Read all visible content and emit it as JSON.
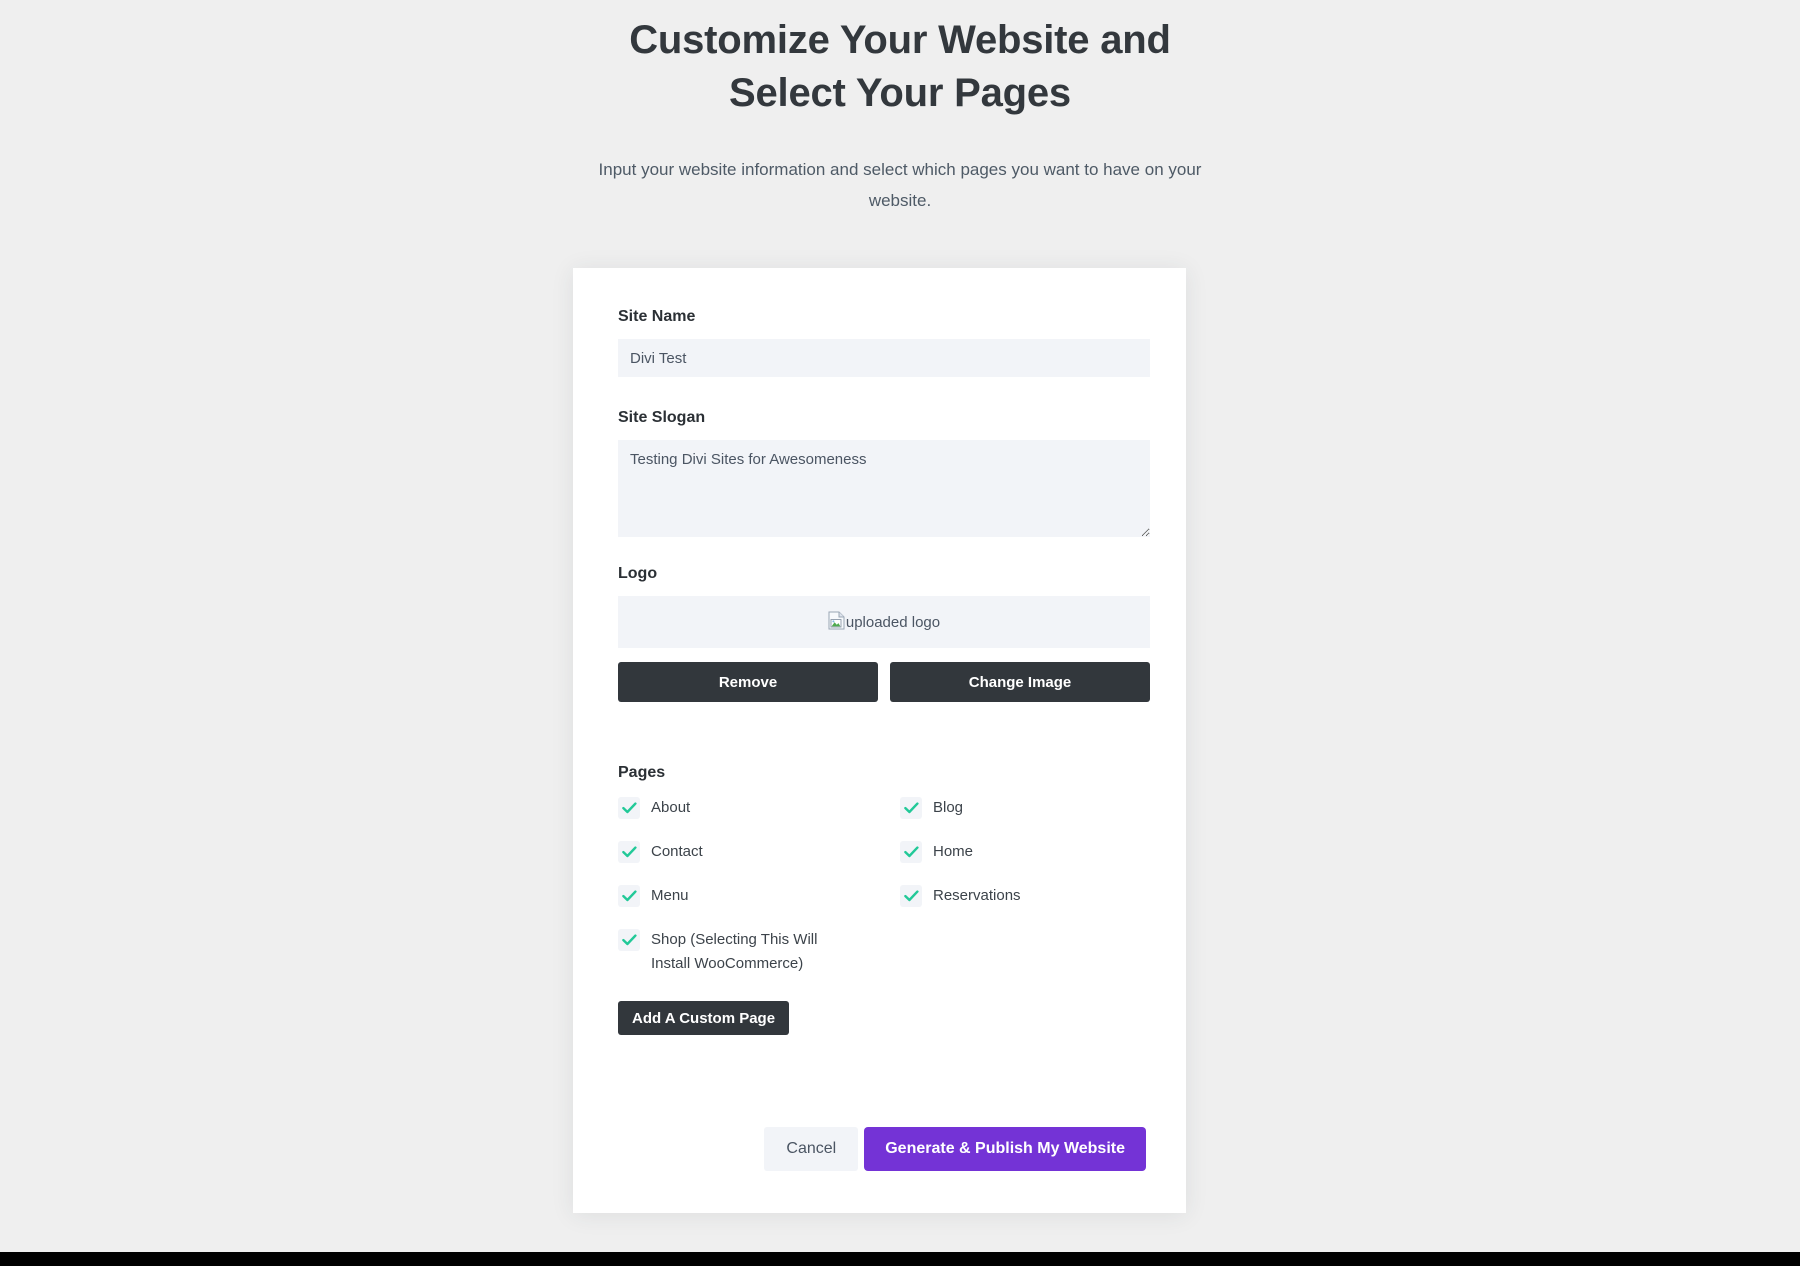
{
  "header": {
    "title": "Customize Your Website and Select Your Pages",
    "subtitle": "Input your website information and select which pages you want to have on your website."
  },
  "form": {
    "site_name": {
      "label": "Site Name",
      "value": "Divi Test",
      "placeholder": "Site Name"
    },
    "site_slogan": {
      "label": "Site Slogan",
      "value": "Testing Divi Sites for Awesomeness",
      "placeholder": "Site Slogan"
    },
    "logo": {
      "label": "Logo",
      "alt_text": "uploaded logo",
      "remove_label": "Remove",
      "change_label": "Change Image"
    }
  },
  "pages": {
    "label": "Pages",
    "add_custom_page_label": "Add A Custom Page",
    "options": [
      {
        "label": "About",
        "checked": true
      },
      {
        "label": "Blog",
        "checked": true
      },
      {
        "label": "Contact",
        "checked": true
      },
      {
        "label": "Home",
        "checked": true
      },
      {
        "label": "Menu",
        "checked": true
      },
      {
        "label": "Reservations",
        "checked": true
      },
      {
        "label": "Shop (Selecting This Will Install WooCommerce)",
        "checked": true
      }
    ]
  },
  "actions": {
    "cancel_label": "Cancel",
    "generate_label": "Generate & Publish My Website"
  },
  "colors": {
    "page_background": "#efefef",
    "card_background": "#ffffff",
    "field_background": "#f2f4f8",
    "dark_button": "#32373c",
    "primary_button": "#7433d6",
    "checkmark": "#22c998",
    "title_text": "#33383d",
    "body_text": "#4e5a66",
    "bottom_bar": "#000000"
  }
}
